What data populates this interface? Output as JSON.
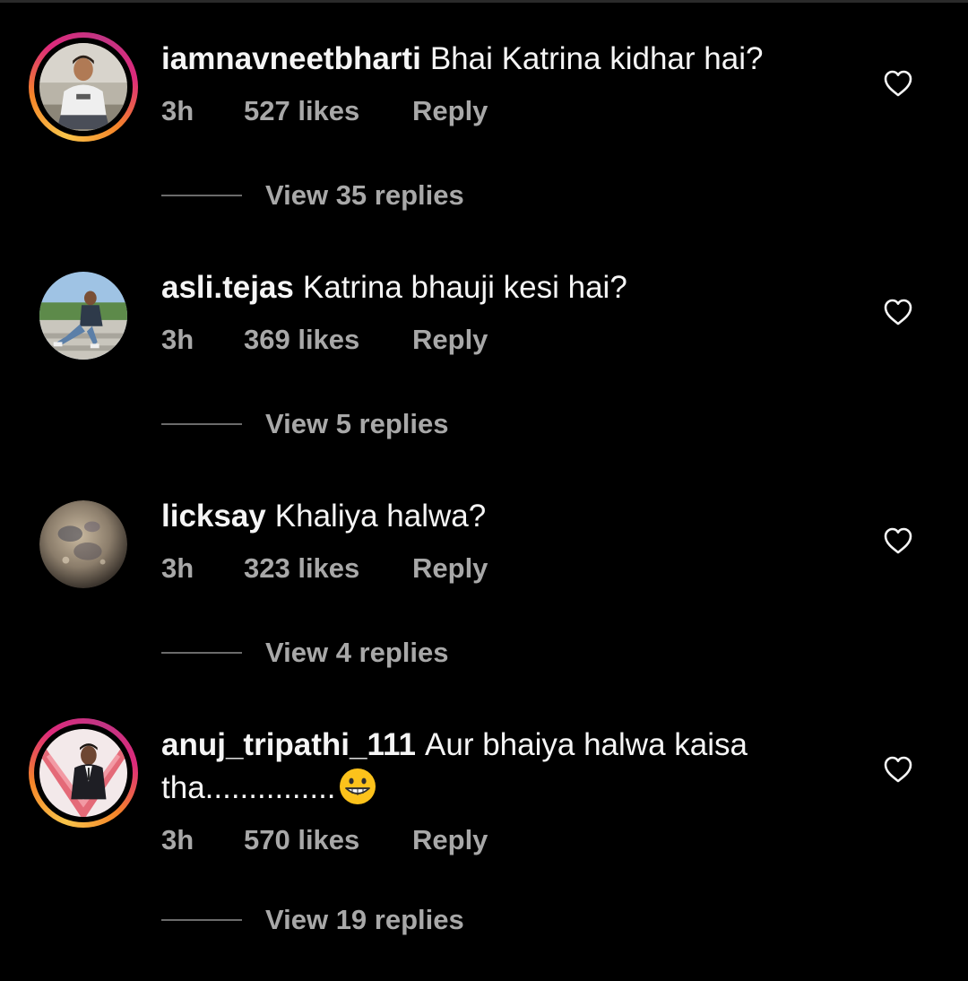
{
  "colors": {
    "background": "#000000",
    "primary_text": "#f5f5f5",
    "secondary_text": "#a8a8a8",
    "story_ring_start": "#f9c44a",
    "story_ring_end": "#dd2a7b"
  },
  "comments": [
    {
      "username": "iamnavneetbharti",
      "text": "Bhai Katrina kidhar hai?",
      "time": "3h",
      "likes": "527 likes",
      "reply_label": "Reply",
      "view_replies": "View 35 replies",
      "has_story_ring": true,
      "avatar_icon": "man-sitting-photo-icon",
      "like_icon": "heart-outline-icon"
    },
    {
      "username": "asli.tejas",
      "text": "Katrina bhauji kesi hai?",
      "time": "3h",
      "likes": "369 likes",
      "reply_label": "Reply",
      "view_replies": "View 5 replies",
      "has_story_ring": false,
      "avatar_icon": "man-on-steps-photo-icon",
      "like_icon": "heart-outline-icon"
    },
    {
      "username": "licksay",
      "text": "Khaliya halwa?",
      "time": "3h",
      "likes": "323 likes",
      "reply_label": "Reply",
      "view_replies": "View 4 replies",
      "has_story_ring": false,
      "avatar_icon": "moon-photo-icon",
      "like_icon": "heart-outline-icon"
    },
    {
      "username": "anuj_tripathi_111",
      "text": "Aur bhaiya halwa kaisa tha...............",
      "emoji": "grinning-face-emoji",
      "time": "3h",
      "likes": "570 likes",
      "reply_label": "Reply",
      "view_replies": "View 19 replies",
      "has_story_ring": true,
      "avatar_icon": "man-in-suit-photo-icon",
      "like_icon": "heart-outline-icon"
    }
  ]
}
